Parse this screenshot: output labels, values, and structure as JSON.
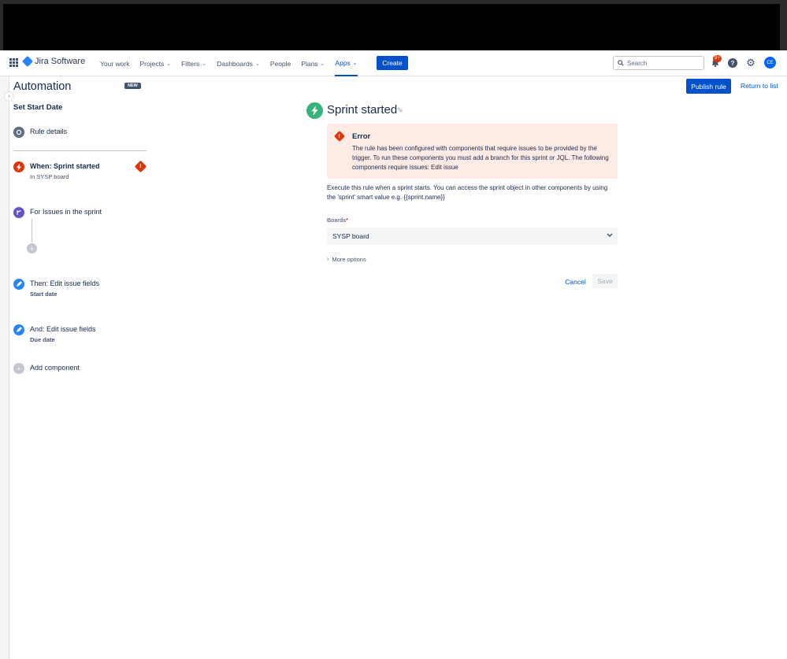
{
  "topnav": {
    "product": "Jira Software",
    "items": [
      {
        "label": "Your work",
        "dropdown": false
      },
      {
        "label": "Projects",
        "dropdown": true
      },
      {
        "label": "Filters",
        "dropdown": true
      },
      {
        "label": "Dashboards",
        "dropdown": true
      },
      {
        "label": "People",
        "dropdown": false
      },
      {
        "label": "Plans",
        "dropdown": true
      },
      {
        "label": "Apps",
        "dropdown": true,
        "active": true
      }
    ],
    "create_label": "Create",
    "search_placeholder": "Search",
    "notification_count": "9+",
    "avatar_initials": "CE"
  },
  "sidebar": {
    "title": "Automation",
    "new_badge": "NEW",
    "rule_name": "Set Start Date",
    "rule_details": "Rule details",
    "steps": [
      {
        "title": "When: Sprint started",
        "sub": "In SYSP board"
      },
      {
        "title": "For Issues in the sprint",
        "sub": ""
      },
      {
        "title": "Then: Edit issue fields",
        "sub": "Start date"
      },
      {
        "title": "And: Edit issue fields",
        "sub": "Due date"
      }
    ],
    "add_component": "Add component"
  },
  "actions": {
    "publish": "Publish rule",
    "return": "Return to list"
  },
  "main": {
    "title": "Sprint started",
    "error": {
      "title": "Error",
      "text": "The rule has been configured with components that require issues to be provided by the trigger. To run these components you must add a branch for this sprint or JQL. The following components require issues: Edit issue"
    },
    "description": "Execute this rule when a sprint starts. You can access the sprint object in other components by using the 'sprint' smart value e.g. {{sprint.name}}",
    "boards_label": "Boards",
    "boards_required": "*",
    "boards_value": "SYSP board",
    "more_options": "More options",
    "cancel": "Cancel",
    "save": "Save"
  },
  "colors": {
    "primary": "#0052cc",
    "error_bg": "#ffebe6",
    "error": "#de350b",
    "trigger": "#36b37e",
    "branch": "#6554c0",
    "action": "#2684ff"
  }
}
